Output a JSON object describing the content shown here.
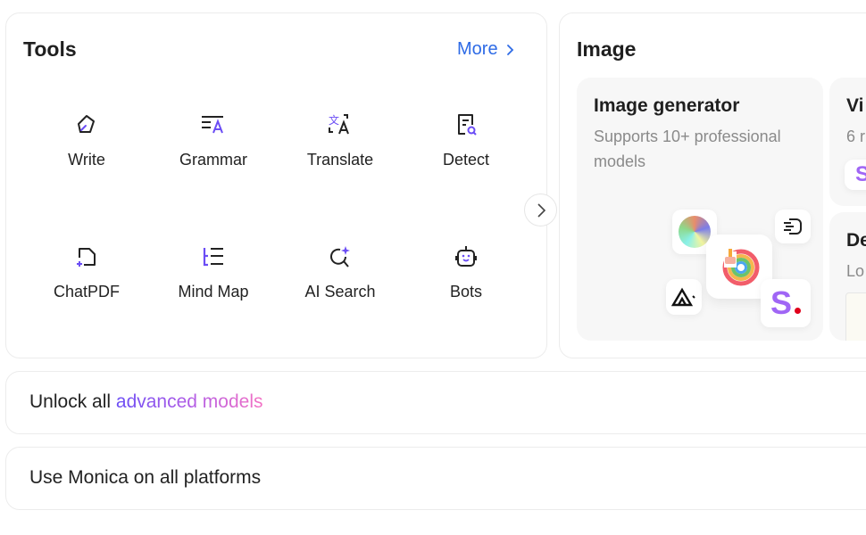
{
  "tools": {
    "title": "Tools",
    "more_label": "More",
    "items": [
      {
        "label": "Write",
        "icon": "pen-icon"
      },
      {
        "label": "Grammar",
        "icon": "grammar-icon"
      },
      {
        "label": "Translate",
        "icon": "translate-icon"
      },
      {
        "label": "Detect",
        "icon": "detect-icon"
      },
      {
        "label": "ChatPDF",
        "icon": "chatpdf-icon"
      },
      {
        "label": "Mind Map",
        "icon": "mindmap-icon"
      },
      {
        "label": "AI Search",
        "icon": "ai-search-icon"
      },
      {
        "label": "Bots",
        "icon": "bot-icon"
      }
    ]
  },
  "image": {
    "title": "Image",
    "generator": {
      "title": "Image generator",
      "desc": "Supports 10+ professional models"
    },
    "card2": {
      "title": "Vi",
      "desc": "6 r"
    },
    "card3": {
      "title": "De",
      "desc": "Lo"
    }
  },
  "banners": {
    "unlock_prefix": "Unlock all",
    "unlock_highlight": "advanced models",
    "platforms": "Use Monica on all platforms"
  },
  "colors": {
    "accent": "#6b4df5",
    "link": "#2e6be6",
    "icon": "#222222"
  }
}
